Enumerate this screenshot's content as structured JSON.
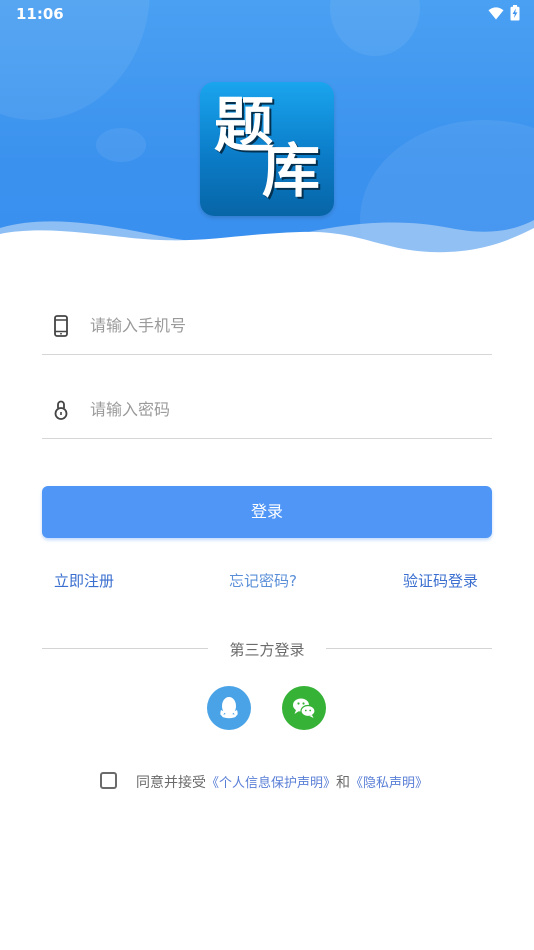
{
  "status_bar": {
    "time": "11:06"
  },
  "logo": {
    "char1": "题",
    "char2": "库"
  },
  "form": {
    "phone_placeholder": "请输入手机号",
    "password_placeholder": "请输入密码",
    "login_label": "登录"
  },
  "links": {
    "register": "立即注册",
    "forgot": "忘记密码?",
    "sms_login": "验证码登录"
  },
  "third_party": {
    "label": "第三方登录"
  },
  "agreement": {
    "prefix": "同意并接受",
    "personal_info": "《个人信息保护声明》",
    "and": "和",
    "privacy": "《隐私声明》"
  },
  "colors": {
    "accent": "#4f96f6",
    "header": "#3b92ee",
    "qq": "#4aa3e6",
    "wechat": "#36b237",
    "link_dark": "#3a6fcf",
    "link_light": "#5a8fd8"
  },
  "icons": {
    "phone": "phone-icon",
    "lock": "lock-icon",
    "qq": "qq-icon",
    "wechat": "wechat-icon"
  }
}
